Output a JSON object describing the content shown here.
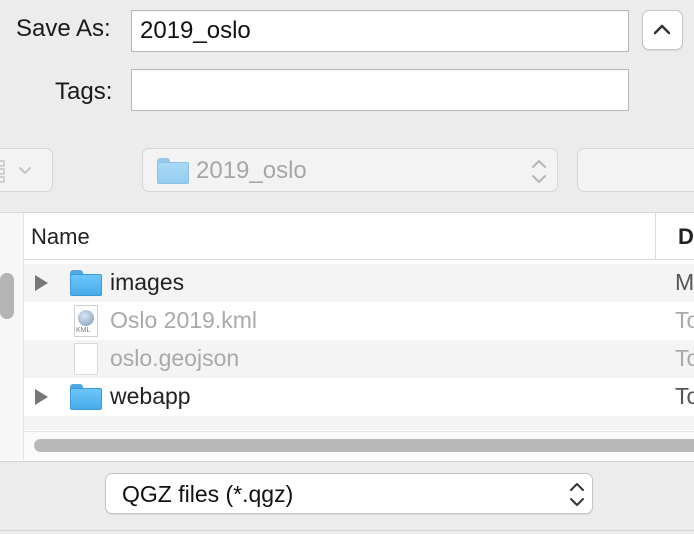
{
  "save_as": {
    "label": "Save As:",
    "value": "2019_oslo"
  },
  "tags": {
    "label": "Tags:",
    "value": ""
  },
  "location": {
    "folder": "2019_oslo"
  },
  "columns": {
    "name": "Name",
    "date": "D"
  },
  "files": [
    {
      "name": "images",
      "date": "M",
      "kind": "folder",
      "enabled": true
    },
    {
      "name": "Oslo 2019.kml",
      "date": "To",
      "kind": "kml",
      "enabled": false
    },
    {
      "name": "oslo.geojson",
      "date": "To",
      "kind": "file",
      "enabled": false
    },
    {
      "name": "webapp",
      "date": "To",
      "kind": "folder",
      "enabled": true
    }
  ],
  "kml_badge": "KML",
  "format": {
    "selected": "QGZ files (*.qgz)"
  },
  "icons": {
    "collapse": "chevron-up-icon",
    "view": "view-mode-icon",
    "location": "folder-icon",
    "stepper": "up-down-arrows-icon",
    "disclosure": "disclosure-triangle-icon"
  },
  "colors": {
    "folder": "#5bb8f3",
    "disabled_text": "#a9a9a9"
  }
}
